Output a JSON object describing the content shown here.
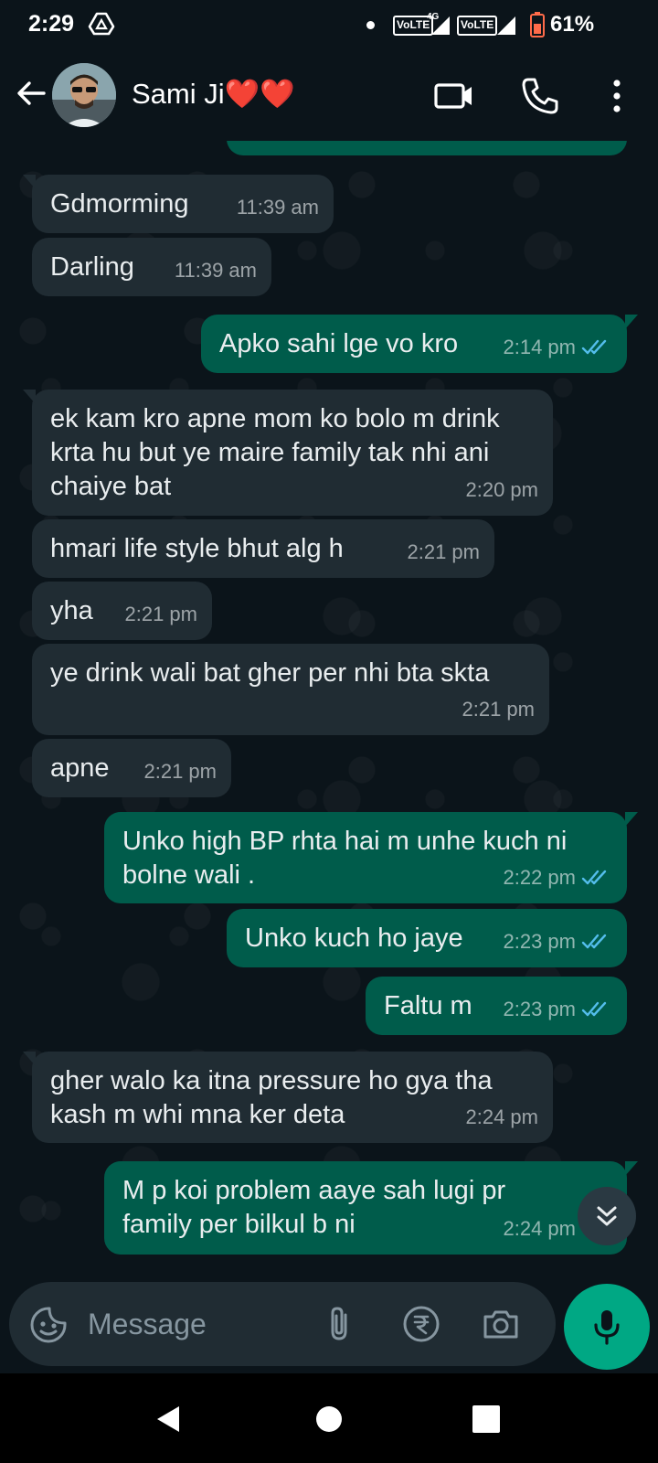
{
  "status_bar": {
    "time": "2:29",
    "volte_1": "VoLTE",
    "network_1": "4G",
    "volte_2": "VoLTE",
    "battery": "61%"
  },
  "header": {
    "contact_name": "Sami Ji❤️❤️",
    "icons": [
      "back-arrow-icon",
      "video-call-icon",
      "voice-call-icon",
      "more-options-icon"
    ]
  },
  "messages": [
    {
      "dir": "in",
      "text": "Gdmorming",
      "time": "11:39 am"
    },
    {
      "dir": "in",
      "text": "Darling",
      "time": "11:39 am"
    },
    {
      "dir": "out",
      "text": "Apko sahi lge vo kro",
      "time": "2:14 pm",
      "read": true
    },
    {
      "dir": "in",
      "text": "ek kam kro apne mom ko bolo m drink krta hu but ye maire family tak nhi ani chaiye bat",
      "time": "2:20 pm"
    },
    {
      "dir": "in",
      "text": "hmari life style bhut alg h",
      "time": "2:21 pm"
    },
    {
      "dir": "in",
      "text": "yha",
      "time": "2:21 pm"
    },
    {
      "dir": "in",
      "text": "ye drink wali bat gher per nhi bta skta",
      "time": "2:21 pm"
    },
    {
      "dir": "in",
      "text": "apne",
      "time": "2:21 pm"
    },
    {
      "dir": "out",
      "text": "Unko high BP rhta hai m unhe kuch ni bolne wali .",
      "time": "2:22 pm",
      "read": true
    },
    {
      "dir": "out",
      "text": "Unko kuch ho jaye",
      "time": "2:23 pm",
      "read": true
    },
    {
      "dir": "out",
      "text": "Faltu m",
      "time": "2:23 pm",
      "read": true
    },
    {
      "dir": "in",
      "text": "gher walo ka itna pressure ho gya tha kash m whi mna ker deta",
      "time": "2:24 pm"
    },
    {
      "dir": "out",
      "text": "M p koi problem aaye sah lugi pr family per bilkul b ni",
      "time": "2:24 pm",
      "read": false
    }
  ],
  "input": {
    "placeholder": "Message"
  },
  "colors": {
    "background": "#0b141a",
    "incoming_bubble": "#202c33",
    "outgoing_bubble": "#005c4b",
    "accent_green": "#00a884",
    "read_ticks": "#53bdeb"
  }
}
